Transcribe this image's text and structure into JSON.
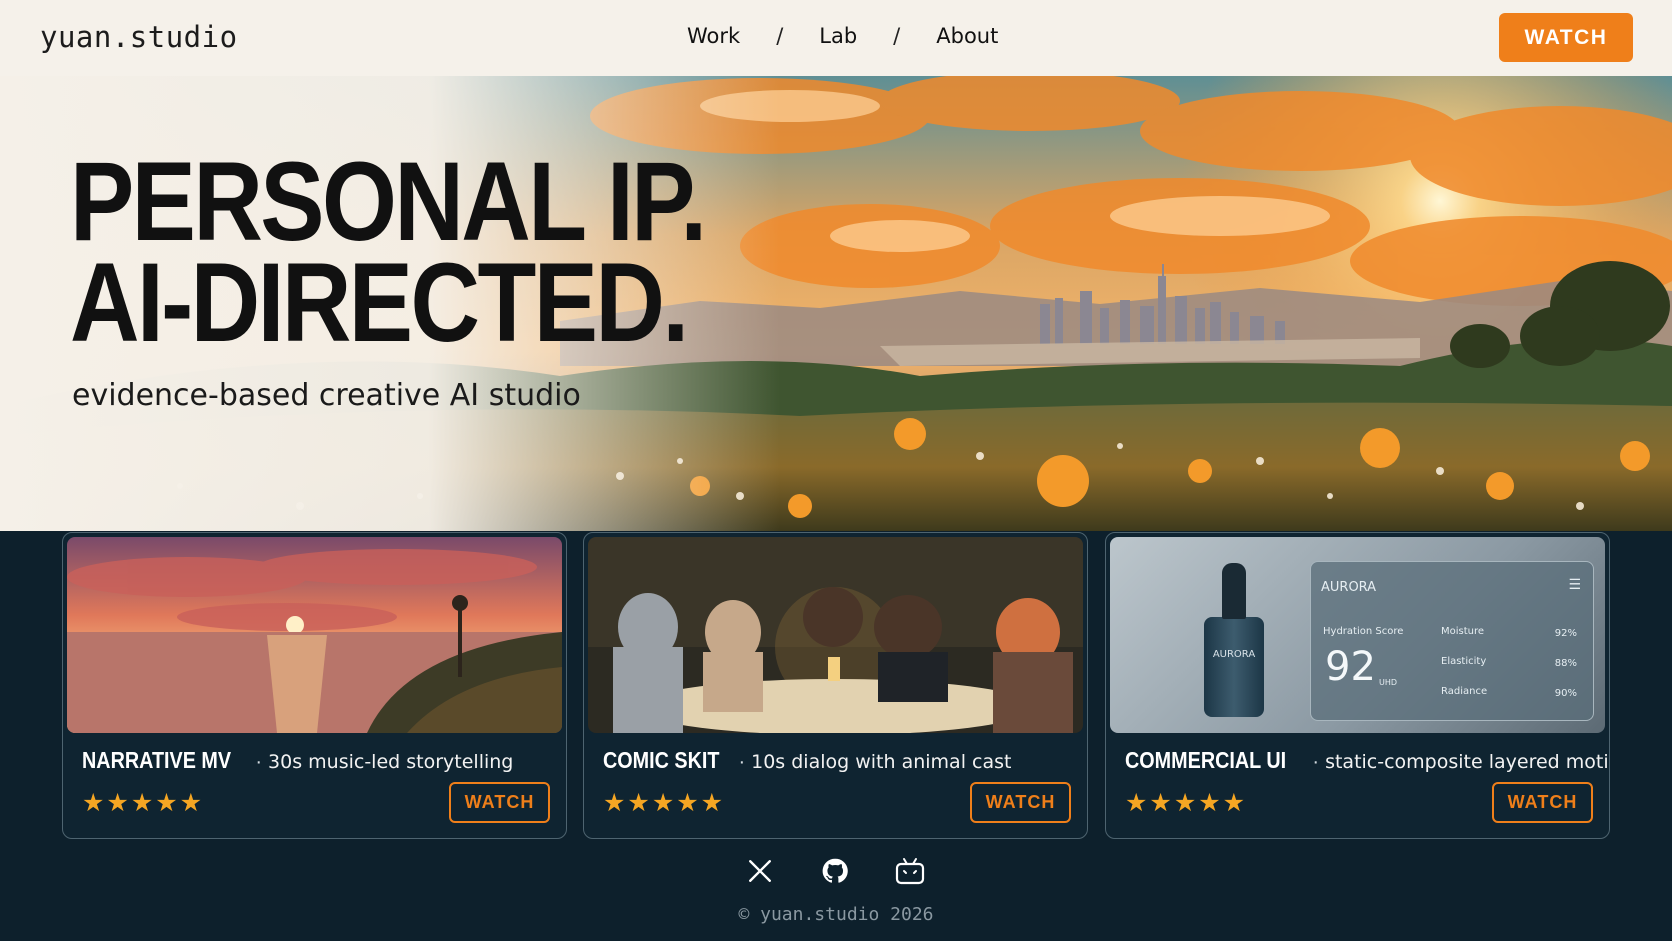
{
  "header": {
    "logo": "yuan.studio",
    "nav": [
      "Work",
      "Lab",
      "About"
    ],
    "separator": "/",
    "cta": "WATCH"
  },
  "hero": {
    "title_line1": "PERSONAL IP.",
    "title_line2": "AI-DIRECTED.",
    "subtitle": "evidence-based creative AI studio"
  },
  "cards": [
    {
      "name": "NARRATIVE MV",
      "separator": "·",
      "desc": "30s music-led storytelling",
      "stars": "★★★★★",
      "rating": 5,
      "button": "WATCH"
    },
    {
      "name": "COMIC SKIT",
      "separator": "·",
      "desc": "10s dialog with animal cast",
      "stars": "★★★★★",
      "rating": 5,
      "button": "WATCH"
    },
    {
      "name": "COMMERCIAL UI",
      "separator": "·",
      "desc": "static-composite layered motion",
      "stars": "★★★★★",
      "rating": 5,
      "button": "WATCH",
      "mockup": {
        "brand": "AURORA",
        "bottle_label": "AURORA",
        "score_label": "Hydration Score",
        "score": "92",
        "score_unit": "UHD",
        "metrics": [
          {
            "label": "Moisture",
            "value": "92%"
          },
          {
            "label": "Elasticity",
            "value": "88%"
          },
          {
            "label": "Radiance",
            "value": "90%"
          }
        ]
      }
    }
  ],
  "footer": {
    "icons": [
      "x-icon",
      "github-icon",
      "bilibili-icon"
    ],
    "copyright": "© yuan.studio 2026"
  },
  "colors": {
    "accent": "#ef7f1a",
    "dark": "#0d202c",
    "header_bg": "#f5f1ea",
    "star": "#f5a623"
  }
}
